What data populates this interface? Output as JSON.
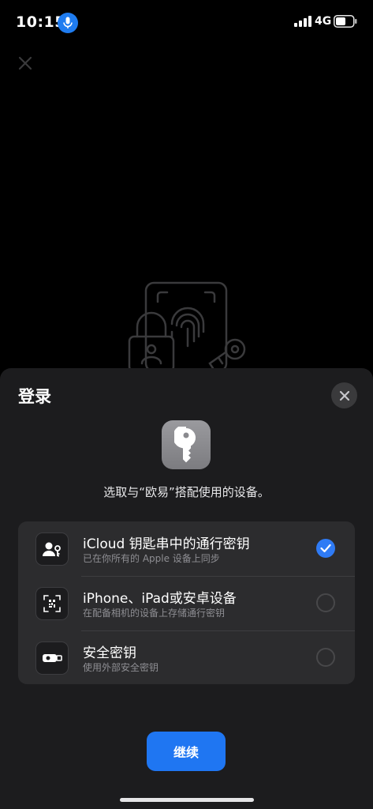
{
  "status_bar": {
    "time": "10:15",
    "network": "4G",
    "mic_icon": "microphone-icon",
    "signal_icon": "cellular-signal-icon",
    "battery_icon": "battery-icon"
  },
  "background": {
    "close_icon": "close-icon",
    "illustration_icon": "passkey-fingerprint-illustration"
  },
  "sheet": {
    "title": "登录",
    "close_icon": "close-icon",
    "app_icon": "key-icon",
    "subtitle": "选取与“欧易”搭配使用的设备。",
    "options": [
      {
        "title": "iCloud 钥匙串中的通行密钥",
        "subtitle": "已在你所有的 Apple 设备上同步",
        "icon": "person-key-icon",
        "selected": true
      },
      {
        "title": "iPhone、iPad或安卓设备",
        "subtitle": "在配备相机的设备上存储通行密钥",
        "icon": "qr-scan-icon",
        "selected": false
      },
      {
        "title": "安全密钥",
        "subtitle": "使用外部安全密钥",
        "icon": "security-key-icon",
        "selected": false
      }
    ],
    "continue_label": "继续"
  },
  "colors": {
    "accent": "#1f76f2",
    "sheet_bg": "#1c1c1e",
    "list_bg": "#2c2c2e",
    "secondary_text": "#8e8e93"
  }
}
